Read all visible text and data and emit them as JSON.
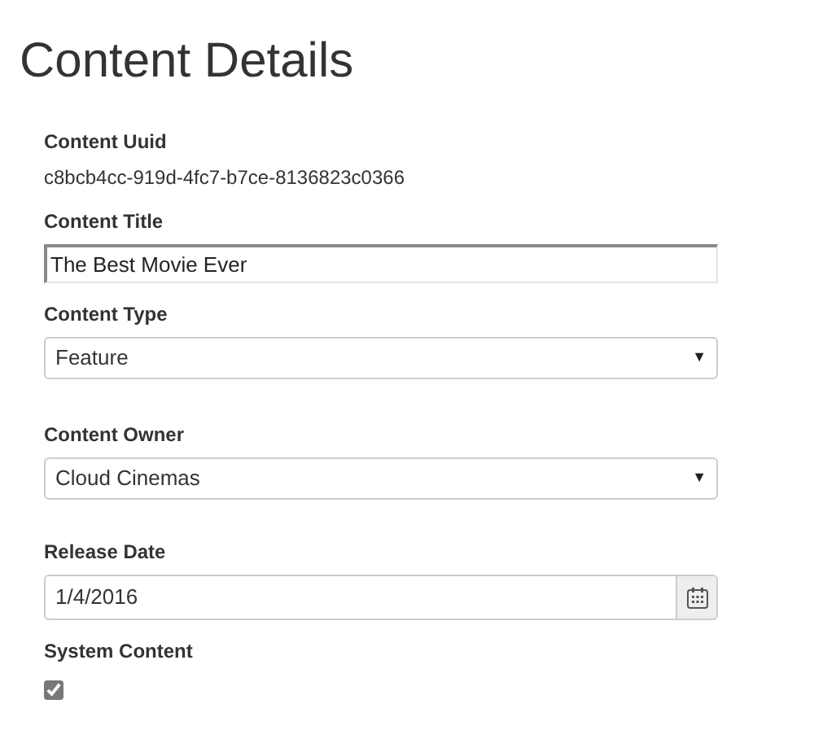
{
  "title": "Content Details",
  "fields": [
    {
      "kind": "text",
      "label": "Content Uuid",
      "value": "c8bcb4cc-919d-4fc7-b7ce-8136823c0366"
    },
    {
      "kind": "input",
      "label": "Content Title",
      "value": "The Best Movie Ever"
    },
    {
      "kind": "select",
      "label": "Content Type",
      "value": "Feature",
      "arrow": "▼"
    },
    {
      "kind": "select",
      "label": "Content Owner",
      "value": "Cloud Cinemas",
      "arrow": "▼"
    },
    {
      "kind": "date",
      "label": "Release Date",
      "value": "1/4/2016"
    },
    {
      "kind": "checkbox",
      "label": "System Content",
      "checked": true
    }
  ]
}
